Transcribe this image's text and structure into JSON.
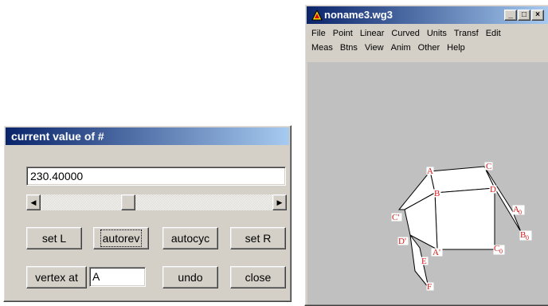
{
  "dialog": {
    "title": "current value of #",
    "value": "230.40000",
    "slider": {
      "fraction": 0.37
    },
    "buttons": {
      "set_l": "set L",
      "autorev": "autorev",
      "autocyc": "autocyc",
      "set_r": "set R",
      "vertex_at": "vertex at",
      "undo": "undo",
      "close": "close"
    },
    "vertex_value": "A"
  },
  "app": {
    "title": "noname3.wg3",
    "controls": [
      "_",
      "□",
      "×"
    ],
    "menu_row1": [
      "File",
      "Point",
      "Linear",
      "Curved",
      "Units",
      "Transf",
      "Edit"
    ],
    "menu_row2": [
      "Meas",
      "Btns",
      "View",
      "Anim",
      "Other",
      "Help"
    ]
  },
  "figure": {
    "label_color": "#d01818",
    "labels": {
      "A": "A",
      "C": "C",
      "B": "B",
      "D": "D",
      "C_prime": "C'",
      "D_prime": "D'",
      "A_prime": "A'",
      "C0": "C",
      "C0_sub": "0",
      "A0": "A",
      "A0_sub": "0",
      "B0": "B",
      "B0_sub": "0",
      "E": "E",
      "F": "F"
    }
  }
}
